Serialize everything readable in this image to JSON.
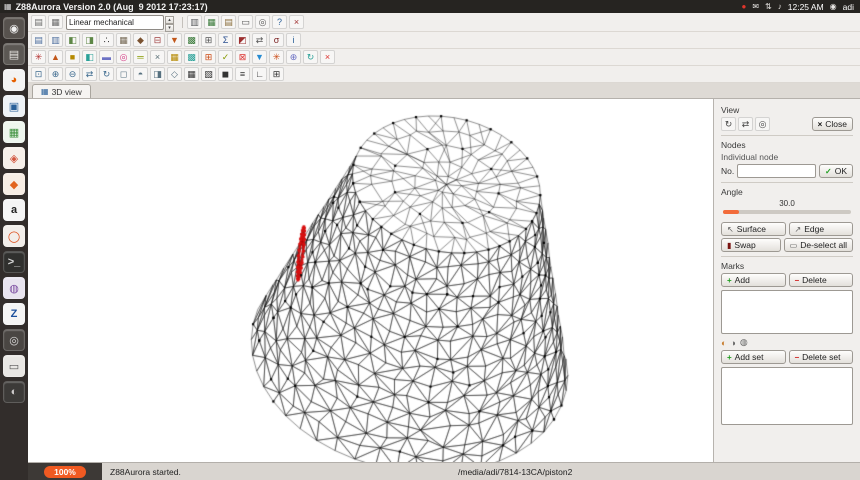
{
  "topbar": {
    "title": "Z88Aurora Version 2.0 (Aug  9 2012 17:23:17)",
    "time": "12:25 AM",
    "user": "adi",
    "app_icon": "▦",
    "tray": [
      {
        "name": "record-indicator-icon",
        "glyph": "●",
        "color": "#e0352b"
      },
      {
        "name": "mail-indicator-icon",
        "glyph": "✉",
        "color": "#e8e6e3"
      },
      {
        "name": "network-indicator-icon",
        "glyph": "⇅",
        "color": "#e8e6e3"
      },
      {
        "name": "volume-indicator-icon",
        "glyph": "♪",
        "color": "#e8e6e3"
      }
    ],
    "session_icon": "◉"
  },
  "launcher": [
    {
      "name": "dash-home-icon",
      "bg": "#57524e",
      "glyph": "◉",
      "fg": "#f1f1f1"
    },
    {
      "name": "files-icon",
      "bg": "#5c5854",
      "glyph": "▤",
      "fg": "#e9e6e2"
    },
    {
      "name": "firefox-icon",
      "bg": "#f3f3f3",
      "glyph": "◕",
      "fg": "#e66000"
    },
    {
      "name": "libreoffice-writer-icon",
      "bg": "#eef2f6",
      "glyph": "▣",
      "fg": "#2a6099"
    },
    {
      "name": "libreoffice-calc-icon",
      "bg": "#eef6ee",
      "glyph": "▦",
      "fg": "#3a8f3a"
    },
    {
      "name": "rhythmbox-icon",
      "bg": "#f6efe9",
      "glyph": "◈",
      "fg": "#d2543c"
    },
    {
      "name": "ubuntu-software-icon",
      "bg": "#f7ede4",
      "glyph": "◆",
      "fg": "#e2641e"
    },
    {
      "name": "amazon-icon",
      "bg": "#f5f5f5",
      "glyph": "a",
      "fg": "#222222"
    },
    {
      "name": "ubuntu-one-icon",
      "bg": "#f2eeea",
      "glyph": "◯",
      "fg": "#dd4814"
    },
    {
      "name": "terminal-icon",
      "bg": "#30302e",
      "glyph": ">_",
      "fg": "#d8d8d8"
    },
    {
      "name": "software-center-icon",
      "bg": "#e8e4ef",
      "glyph": "◍",
      "fg": "#7b4ba0"
    },
    {
      "name": "z88aurora-icon",
      "bg": "#f4f4f4",
      "glyph": "Z",
      "fg": "#1b4f9c"
    },
    {
      "name": "system-settings-icon",
      "bg": "#4a4643",
      "glyph": "◎",
      "fg": "#dddddd"
    },
    {
      "name": "printer-tool-icon",
      "bg": "#e9e7e4",
      "glyph": "▭",
      "fg": "#555555"
    },
    {
      "name": "backup-icon",
      "bg": "#3c3a38",
      "glyph": "◐",
      "fg": "#cfcccc"
    }
  ],
  "toolbar": {
    "mode_value": "Linear mechanical",
    "spin_up": "▴",
    "spin_down": "▾",
    "row1_left": [
      {
        "name": "new-model-icon",
        "glyph": "▤",
        "color": "#6d6d6d"
      },
      {
        "name": "open-model-icon",
        "glyph": "▦",
        "color": "#6d6d6d"
      }
    ],
    "row1_right": [
      {
        "name": "solver-settings-icon",
        "glyph": "▥",
        "color": "#56595c"
      },
      {
        "name": "mesh-generator-icon",
        "glyph": "▦",
        "color": "#3a7a3a"
      },
      {
        "name": "material-db-icon",
        "glyph": "▤",
        "color": "#8a6d3b"
      },
      {
        "name": "printer-icon",
        "glyph": "▭",
        "color": "#555555"
      },
      {
        "name": "snapshot-icon",
        "glyph": "◎",
        "color": "#555555"
      },
      {
        "name": "help-icon",
        "glyph": "?",
        "color": "#2a6099"
      },
      {
        "name": "quit-icon",
        "glyph": "×",
        "color": "#a03030"
      }
    ],
    "row2": [
      {
        "name": "open-project-icon",
        "glyph": "▤",
        "color": "#4d6e9e"
      },
      {
        "name": "save-project-icon",
        "glyph": "▥",
        "color": "#4d6e9e"
      },
      {
        "name": "import-geometry-icon",
        "glyph": "◧",
        "color": "#5e8747"
      },
      {
        "name": "export-geometry-icon",
        "glyph": "◨",
        "color": "#5e8747"
      },
      {
        "name": "nodes-tool-icon",
        "glyph": "∴",
        "color": "#333333"
      },
      {
        "name": "elements-tool-icon",
        "glyph": "▦",
        "color": "#766a56"
      },
      {
        "name": "material-tool-icon",
        "glyph": "◆",
        "color": "#7a5230"
      },
      {
        "name": "constraints-tool-icon",
        "glyph": "⊟",
        "color": "#a04040"
      },
      {
        "name": "loads-tool-icon",
        "glyph": "▼",
        "color": "#c2571a"
      },
      {
        "name": "mesh-tool-icon",
        "glyph": "▩",
        "color": "#3a7a3a"
      },
      {
        "name": "superelement-icon",
        "glyph": "⊞",
        "color": "#555555"
      },
      {
        "name": "solver-tool-icon",
        "glyph": "Σ",
        "color": "#2a4f8f"
      },
      {
        "name": "results-tool-icon",
        "glyph": "◩",
        "color": "#9c2f2f"
      },
      {
        "name": "displacement-icon",
        "glyph": "⇄",
        "color": "#555555"
      },
      {
        "name": "stress-icon",
        "glyph": "σ",
        "color": "#7a1f1f"
      },
      {
        "name": "info-tool-icon",
        "glyph": "i",
        "color": "#2a6099"
      }
    ],
    "row3": [
      {
        "name": "spider-structure-icon",
        "glyph": "✳",
        "color": "#b33030"
      },
      {
        "name": "tetrahedron-icon",
        "glyph": "▲",
        "color": "#c2571a"
      },
      {
        "name": "hexahedron-icon",
        "glyph": "■",
        "color": "#b58900"
      },
      {
        "name": "shell-element-icon",
        "glyph": "◧",
        "color": "#2aa198"
      },
      {
        "name": "plate-element-icon",
        "glyph": "▬",
        "color": "#6c71c4"
      },
      {
        "name": "torus-element-icon",
        "glyph": "◎",
        "color": "#d33682"
      },
      {
        "name": "beam-element-icon",
        "glyph": "═",
        "color": "#859900"
      },
      {
        "name": "truss-element-icon",
        "glyph": "×",
        "color": "#586e75"
      },
      {
        "name": "mapped-mesh-icon",
        "glyph": "▦",
        "color": "#b58900"
      },
      {
        "name": "free-mesh-icon",
        "glyph": "▩",
        "color": "#2aa198"
      },
      {
        "name": "refine-mesh-icon",
        "glyph": "⊞",
        "color": "#cb4b16"
      },
      {
        "name": "check-mesh-icon",
        "glyph": "✓",
        "color": "#859900"
      },
      {
        "name": "boundary-icon",
        "glyph": "⊠",
        "color": "#dc322f"
      },
      {
        "name": "pressure-load-icon",
        "glyph": "▼",
        "color": "#268bd2"
      },
      {
        "name": "temperature-load-icon",
        "glyph": "✳",
        "color": "#cb4b16"
      },
      {
        "name": "gravity-load-icon",
        "glyph": "⊕",
        "color": "#6c71c4"
      },
      {
        "name": "rotation-load-icon",
        "glyph": "↻",
        "color": "#2aa198"
      },
      {
        "name": "delete-structure-icon",
        "glyph": "×",
        "color": "#dc322f"
      }
    ],
    "row4": [
      {
        "name": "zoom-fit-icon",
        "glyph": "⊡",
        "color": "#3d6a8f"
      },
      {
        "name": "zoom-in-icon",
        "glyph": "⊕",
        "color": "#3d6a8f"
      },
      {
        "name": "zoom-out-icon",
        "glyph": "⊖",
        "color": "#3d6a8f"
      },
      {
        "name": "pan-icon",
        "glyph": "⇄",
        "color": "#3d6a8f"
      },
      {
        "name": "rotate-view-icon",
        "glyph": "↻",
        "color": "#3d6a8f"
      },
      {
        "name": "front-view-icon",
        "glyph": "◻",
        "color": "#56707f"
      },
      {
        "name": "top-view-icon",
        "glyph": "◓",
        "color": "#56707f"
      },
      {
        "name": "side-view-icon",
        "glyph": "◨",
        "color": "#56707f"
      },
      {
        "name": "iso-view-icon",
        "glyph": "◇",
        "color": "#56707f"
      },
      {
        "name": "wireframe-icon",
        "glyph": "▦",
        "color": "#333333"
      },
      {
        "name": "hidden-line-icon",
        "glyph": "▧",
        "color": "#333333"
      },
      {
        "name": "shaded-view-icon",
        "glyph": "◼",
        "color": "#333333"
      },
      {
        "name": "labels-icon",
        "glyph": "≡",
        "color": "#333333"
      },
      {
        "name": "axes-icon",
        "glyph": "∟",
        "color": "#333333"
      },
      {
        "name": "fullscreen-icon",
        "glyph": "⊞",
        "color": "#333333"
      }
    ]
  },
  "tab": {
    "label": "3D view",
    "icon_glyph": "▦"
  },
  "panel": {
    "view": {
      "title": "View",
      "tools": [
        {
          "name": "view-rotate-icon",
          "glyph": "↻",
          "color": "#444444"
        },
        {
          "name": "view-move-icon",
          "glyph": "⇄",
          "color": "#444444"
        },
        {
          "name": "view-zoom-icon",
          "glyph": "◎",
          "color": "#444444"
        }
      ],
      "close_label": "Close",
      "close_icon": "×"
    },
    "nodes": {
      "title": "Nodes",
      "individual_label": "Individual node",
      "no_label": "No.",
      "input_value": "",
      "ok_label": "OK",
      "ok_icon": "✓"
    },
    "angle": {
      "title": "Angle",
      "value": "30.0"
    },
    "select": {
      "surface_label": "Surface",
      "surface_icon": "↖",
      "edge_label": "Edge",
      "edge_icon": "↗",
      "swap_label": "Swap",
      "swap_icon": "▮",
      "deselect_label": "De-select all",
      "deselect_icon": "▭"
    },
    "marks": {
      "title": "Marks",
      "add_label": "Add",
      "add_icon": "+",
      "delete_label": "Delete",
      "delete_icon": "−",
      "addset_label": "Add set",
      "addset_icon": "+",
      "deleteset_label": "Delete set",
      "deleteset_icon": "−",
      "visibility": [
        {
          "name": "mark-visible-icon",
          "glyph": "◐",
          "color": "#c77d2e"
        },
        {
          "name": "mark-hidden-icon",
          "glyph": "◑",
          "color": "#666666"
        },
        {
          "name": "mark-solo-icon",
          "glyph": "◍",
          "color": "#666666"
        }
      ]
    }
  },
  "statusbar": {
    "progress": "100%",
    "message": "Z88Aurora started.",
    "path": "/media/adi/7814-13CA/piston2"
  },
  "colors": {
    "accent_orange": "#f15a22",
    "mesh_highlight": "#cc1010"
  }
}
